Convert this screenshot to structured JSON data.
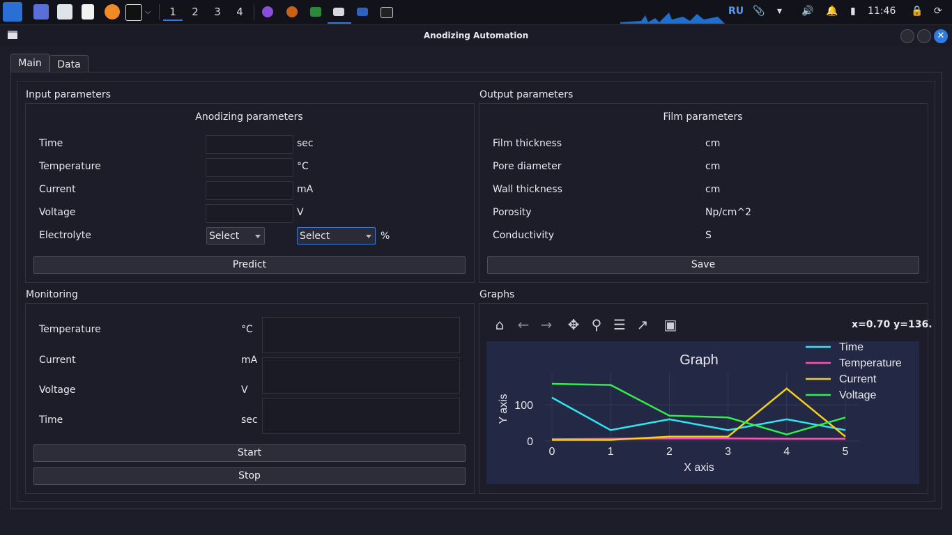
{
  "taskbar": {
    "workspaces": [
      "1",
      "2",
      "3",
      "4"
    ],
    "tray_lang": "RU",
    "clock": "11:46"
  },
  "window": {
    "title": "Anodizing Automation"
  },
  "tabs": [
    {
      "label": "Main"
    },
    {
      "label": "Data"
    }
  ],
  "input": {
    "group_title": "Input parameters",
    "subtitle": "Anodizing parameters",
    "rows": [
      {
        "label": "Time",
        "unit": "sec"
      },
      {
        "label": "Temperature",
        "unit": "°C"
      },
      {
        "label": "Current",
        "unit": "mA"
      },
      {
        "label": "Voltage",
        "unit": "V"
      }
    ],
    "electrolyte_label": "Electrolyte",
    "select1": "Select",
    "select2": "Select",
    "percent": "%",
    "predict_label": "Predict"
  },
  "output": {
    "group_title": "Output parameters",
    "subtitle": "Film parameters",
    "rows": [
      {
        "label": "Film thickness",
        "unit": "cm"
      },
      {
        "label": "Pore diameter",
        "unit": "cm"
      },
      {
        "label": "Wall thickness",
        "unit": "cm"
      },
      {
        "label": "Porosity",
        "unit": "Np/cm^2"
      },
      {
        "label": "Conductivity",
        "unit": "S"
      }
    ],
    "save_label": "Save"
  },
  "monitoring": {
    "group_title": "Monitoring",
    "rows": [
      {
        "label": "Temperature",
        "unit": "°C"
      },
      {
        "label": "Current",
        "unit": "mA"
      },
      {
        "label": "Voltage",
        "unit": "V"
      },
      {
        "label": "Time",
        "unit": "sec"
      }
    ],
    "start_label": "Start",
    "stop_label": "Stop"
  },
  "graphs": {
    "group_title": "Graphs",
    "coords": "x=0.70 y=136."
  },
  "colors": {
    "time": "#2ee6f0",
    "temperature": "#ff4fb0",
    "current": "#f2cf1a",
    "voltage": "#2fef4a",
    "accent": "#3a7bd5"
  },
  "chart_data": {
    "type": "line",
    "title": "Graph",
    "xlabel": "X axis",
    "ylabel": "Y axis",
    "x": [
      0,
      1,
      2,
      3,
      4,
      5
    ],
    "xlim": [
      0,
      5
    ],
    "ylim": [
      0,
      160
    ],
    "yticks": [
      0,
      100
    ],
    "grid": true,
    "legend_position": "top-right",
    "series": [
      {
        "name": "Time",
        "values": [
          120,
          30,
          60,
          30,
          60,
          30
        ]
      },
      {
        "name": "Temperature",
        "values": [
          5,
          6,
          7,
          7,
          6,
          6
        ]
      },
      {
        "name": "Current",
        "values": [
          3,
          3,
          12,
          12,
          145,
          12
        ]
      },
      {
        "name": "Voltage",
        "values": [
          158,
          155,
          70,
          65,
          18,
          65
        ]
      }
    ]
  }
}
